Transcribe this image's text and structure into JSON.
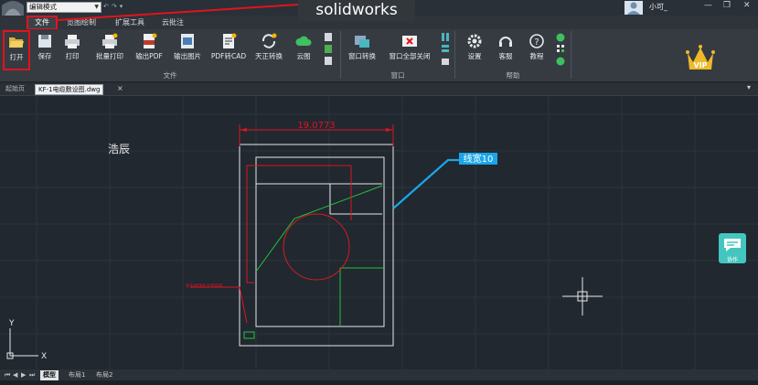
{
  "titlebar": {
    "mode": "编辑模式",
    "overlay_label": "solidworks",
    "user_name": "小可_",
    "window_controls": [
      "—",
      "❐",
      "✕"
    ]
  },
  "ribbon": {
    "tabs": [
      "文件",
      "览图绘制",
      "扩展工具",
      "云批注"
    ],
    "file_buttons": [
      "打开",
      "保存",
      "打印",
      "批量打印",
      "输出PDF",
      "输出图片",
      "PDF转CAD",
      "天正转换",
      "云图"
    ],
    "window_buttons": [
      "窗口转换",
      "窗口全部关闭"
    ],
    "help_buttons": [
      "设置",
      "客服",
      "教程"
    ],
    "groups": {
      "file": "文件",
      "window": "窗口",
      "help": "帮助"
    },
    "vip": "VIP"
  },
  "document_tabs": [
    "起始页",
    "KF-1电缆敷设图.dwg"
  ],
  "drawing": {
    "label_haochen": "浩辰",
    "dimension": "19.0773",
    "callout": "线宽10",
    "red_note": "双击修改此文字内容",
    "axis_x": "X",
    "axis_y": "Y"
  },
  "collab_label": "协作",
  "layout_tabs": [
    "模型",
    "布局1",
    "布局2"
  ],
  "nav_arrows": [
    "⏮",
    "◀",
    "▶",
    "⏭"
  ],
  "colors": {
    "annotation_red": "#e0141d",
    "callout_blue": "#1aa6e8",
    "geometry_green": "#22c33a",
    "geometry_white": "#e8e8e8",
    "circle_red": "#d91c1c",
    "collab_teal": "#43c6c0"
  }
}
